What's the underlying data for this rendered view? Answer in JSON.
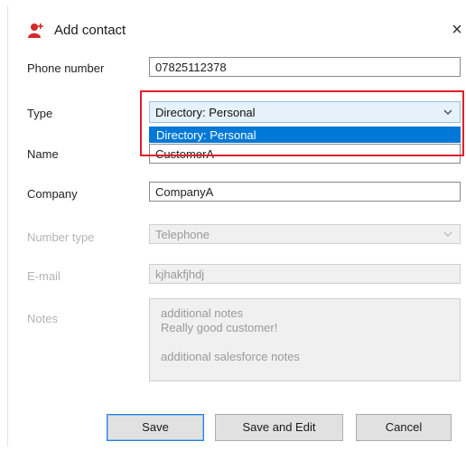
{
  "dialog": {
    "title": "Add contact",
    "title_icon": "add-contact-icon",
    "close_label": "×"
  },
  "form": {
    "phone_number": {
      "label": "Phone number",
      "value": "07825112378"
    },
    "type": {
      "label": "Type",
      "selected": "Directory: Personal",
      "options": [
        "Directory: Personal"
      ]
    },
    "name": {
      "label": "Name",
      "value": "CustomerA"
    },
    "company": {
      "label": "Company",
      "value": "CompanyA"
    },
    "number_type": {
      "label": "Number type",
      "value": "Telephone"
    },
    "email": {
      "label": "E-mail",
      "value": "kjhakfjhdj"
    },
    "notes": {
      "label": "Notes",
      "lines": [
        "additional notes",
        "Really good customer!",
        "",
        "additional salesforce notes"
      ]
    }
  },
  "buttons": {
    "save": "Save",
    "save_and_edit": "Save and Edit",
    "cancel": "Cancel"
  },
  "colors": {
    "highlight": "#0078d7",
    "annotation_border": "#e0202b",
    "icon_red": "#d42a2a"
  }
}
